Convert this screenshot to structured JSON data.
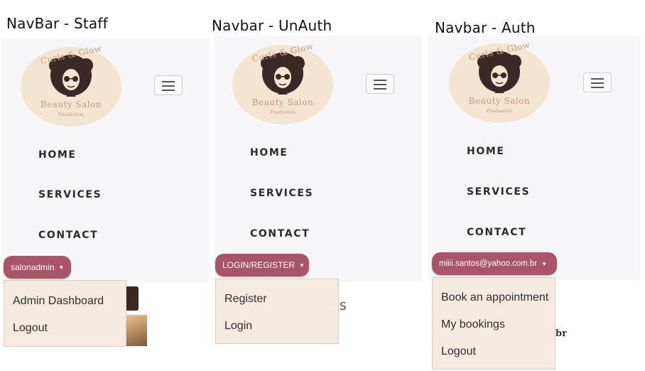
{
  "captions": [
    "NavBar - Staff",
    "Navbar - UnAuth",
    "Navbar - Auth"
  ],
  "logo": {
    "brand": "Curls & Glow",
    "name": "Beauty Salon",
    "tagline": "Finalization"
  },
  "nav_links": [
    "HOME",
    "SERVICES",
    "CONTACT"
  ],
  "staff": {
    "dropdown_label": "salonadmin",
    "menu": [
      "Admin Dashboard",
      "Logout"
    ]
  },
  "unauth": {
    "dropdown_label": "LOGIN/REGISTER",
    "menu": [
      "Register",
      "Login"
    ],
    "bg_fragment": "S"
  },
  "auth": {
    "dropdown_label": "miiii.santos@yahoo.com.br",
    "menu": [
      "Book an appointment",
      "My bookings",
      "Logout"
    ],
    "bg_fragment": "br"
  },
  "colors": {
    "panel": "#f7f7f9",
    "logo_bg": "#f4e5d3",
    "logo_ink": "#c99a82",
    "dropdown": "#a85469",
    "menu_bg": "#f6ebe0"
  }
}
